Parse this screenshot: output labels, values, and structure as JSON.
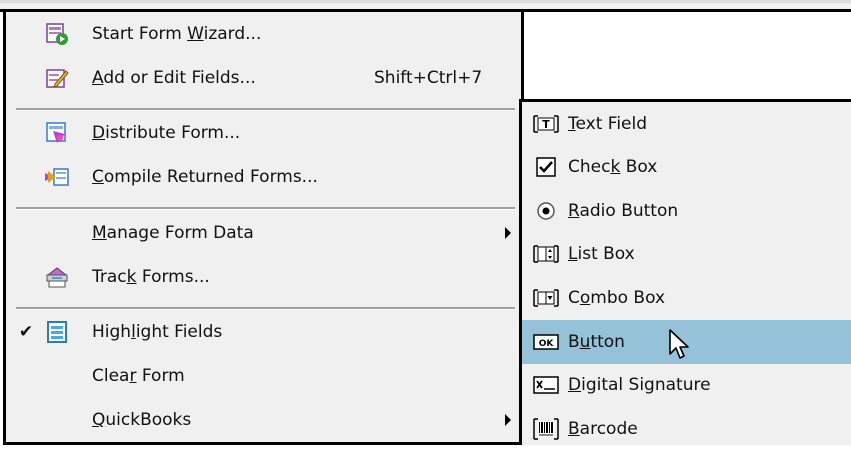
{
  "main_menu": {
    "items": [
      {
        "name": "start-form-wizard",
        "pre": "Start Form ",
        "u": "W",
        "post": "izard...",
        "shortcut": "",
        "icon": "form-wizard-icon"
      },
      {
        "name": "add-or-edit-fields",
        "pre": "",
        "u": "A",
        "post": "dd or Edit Fields...",
        "shortcut": "Shift+Ctrl+7",
        "icon": "edit-fields-icon"
      },
      {
        "name": "distribute-form",
        "pre": "",
        "u": "D",
        "post": "istribute Form...",
        "shortcut": "",
        "icon": "distribute-form-icon"
      },
      {
        "name": "compile-returned-forms",
        "pre": "",
        "u": "C",
        "post": "ompile Returned Forms...",
        "shortcut": "",
        "icon": "compile-forms-icon"
      },
      {
        "name": "manage-form-data",
        "pre": "",
        "u": "M",
        "post": "anage Form Data",
        "shortcut": "",
        "icon": ""
      },
      {
        "name": "track-forms",
        "pre": "Trac",
        "u": "k",
        "post": " Forms...",
        "shortcut": "",
        "icon": "track-forms-icon"
      },
      {
        "name": "highlight-fields",
        "pre": "High",
        "u": "l",
        "post": "ight Fields",
        "shortcut": "",
        "icon": "highlight-fields-icon"
      },
      {
        "name": "clear-form",
        "pre": "Clea",
        "u": "r",
        "post": " Form",
        "shortcut": "",
        "icon": ""
      },
      {
        "name": "quickbooks",
        "pre": "",
        "u": "Q",
        "post": "uickBooks",
        "shortcut": "",
        "icon": ""
      }
    ],
    "checked_item": "highlight-fields",
    "check_glyph": "✔"
  },
  "sub_menu": {
    "items": [
      {
        "name": "text-field",
        "pre": "",
        "u": "T",
        "post": "ext Field",
        "icon": "text-field-icon"
      },
      {
        "name": "check-box",
        "pre": "Chec",
        "u": "k",
        "post": " Box",
        "icon": "check-box-icon"
      },
      {
        "name": "radio-button",
        "pre": "",
        "u": "R",
        "post": "adio Button",
        "icon": "radio-button-icon"
      },
      {
        "name": "list-box",
        "pre": "",
        "u": "L",
        "post": "ist Box",
        "icon": "list-box-icon"
      },
      {
        "name": "combo-box",
        "pre": "C",
        "u": "o",
        "post": "mbo Box",
        "icon": "combo-box-icon"
      },
      {
        "name": "button",
        "pre": "B",
        "u": "u",
        "post": "tton",
        "icon": "button-icon"
      },
      {
        "name": "digital-signature",
        "pre": "",
        "u": "D",
        "post": "igital Signature",
        "icon": "digital-signature-icon"
      },
      {
        "name": "barcode",
        "pre": "",
        "u": "B",
        "post": "arcode",
        "icon": "barcode-icon"
      }
    ],
    "highlighted_item": "button",
    "button_icon_text": "OK",
    "highlight_color": "#95c2d8"
  }
}
